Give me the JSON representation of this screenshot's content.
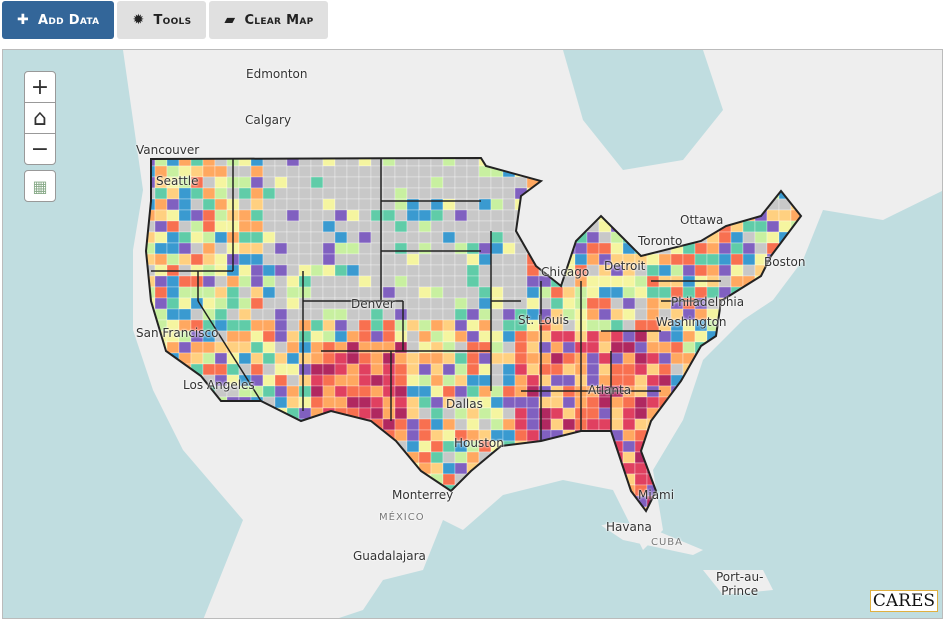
{
  "toolbar": {
    "add_data": "Add Data",
    "tools": "Tools",
    "clear_map": "Clear Map"
  },
  "map_controls": {
    "zoom_in": "+",
    "zoom_out": "−"
  },
  "labels": [
    {
      "text": "Edmonton",
      "cls": ""
    },
    {
      "text": "Calgary",
      "cls": ""
    },
    {
      "text": "Vancouver",
      "cls": ""
    },
    {
      "text": "Seattle",
      "cls": ""
    },
    {
      "text": "Ottawa",
      "cls": ""
    },
    {
      "text": "Toronto",
      "cls": ""
    },
    {
      "text": "Boston",
      "cls": ""
    },
    {
      "text": "Chicago",
      "cls": ""
    },
    {
      "text": "Detroit",
      "cls": ""
    },
    {
      "text": "Denver",
      "cls": ""
    },
    {
      "text": "Philadelphia",
      "cls": ""
    },
    {
      "text": "Washington",
      "cls": ""
    },
    {
      "text": "San Francisco",
      "cls": ""
    },
    {
      "text": "St. Louis",
      "cls": ""
    },
    {
      "text": "Los Angeles",
      "cls": ""
    },
    {
      "text": "Dallas",
      "cls": ""
    },
    {
      "text": "Atlanta",
      "cls": ""
    },
    {
      "text": "Houston",
      "cls": ""
    },
    {
      "text": "Monterrey",
      "cls": ""
    },
    {
      "text": "Miami",
      "cls": ""
    },
    {
      "text": "MÉXICO",
      "cls": "small"
    },
    {
      "text": "Havana",
      "cls": ""
    },
    {
      "text": "CUBA",
      "cls": "small"
    },
    {
      "text": "Guadalajara",
      "cls": ""
    },
    {
      "text": "Port-au-\nPrince",
      "cls": ""
    }
  ],
  "logo": "CARES",
  "colors": {
    "water": "#c0dde0",
    "land": "#eeeeee",
    "nodata": "#c8c8c8",
    "palette": [
      "#c8c8c8",
      "#f5f5a0",
      "#c8f0a0",
      "#60cca8",
      "#3a9ad0",
      "#8060c0",
      "#ffd080",
      "#ffa860",
      "#f87050",
      "#e04060",
      "#b02860"
    ]
  }
}
